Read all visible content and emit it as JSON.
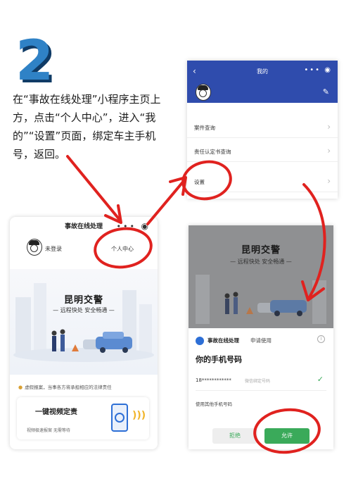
{
  "step": {
    "number": "2"
  },
  "instruction": "在“事故在线处理”小程序主页上方，点击“个人中心”，进入“我的”“设置”页面，绑定车主手机号，返回。",
  "screen_home": {
    "title": "事故在线处理",
    "login_status": "未登录",
    "personal_center": "个人中心",
    "brand_title": "昆明交警",
    "brand_slogan": "— 远程快处 安全畅通 —",
    "notice": "虚假报案，当事各方将承担相应的法律责任",
    "video_card": {
      "title": "一键视频定责",
      "subtitle": "视频极速报案 无需等待"
    }
  },
  "screen_profile": {
    "back": "‹",
    "title": "我的",
    "capsule": "•••",
    "menu": [
      {
        "label": "案件查询"
      },
      {
        "label": "责任认定书查询"
      },
      {
        "label": "设置"
      }
    ]
  },
  "screen_auth": {
    "brand_title": "昆明交警",
    "brand_slogan": "— 远程快处 安全畅通 —",
    "app_name": "事故在线处理",
    "apply_text": "申请使用",
    "heading": "你的手机号码",
    "phone": "18************",
    "phone_note": "微信绑定号码",
    "use_other": "使用其他手机号码",
    "reject": "拒绝",
    "allow": "允许"
  },
  "colors": {
    "accent_blue": "#2f4cad",
    "annotation_red": "#e0221f",
    "allow_green": "#3aaa5a",
    "step_blue": "#2f82c6"
  }
}
